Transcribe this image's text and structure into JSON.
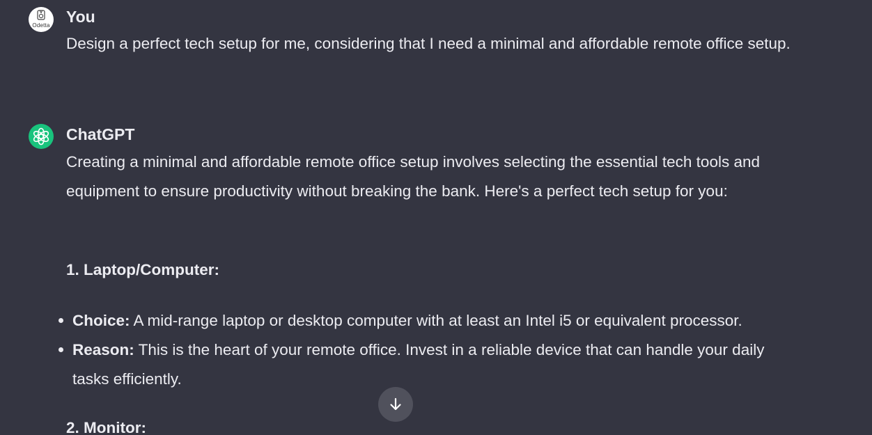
{
  "conversation": {
    "user": {
      "author": "You",
      "avatar_text": "Odetta",
      "message": "Design a perfect tech setup for me, considering that I need a minimal and affordable remote office setup."
    },
    "assistant": {
      "author": "ChatGPT",
      "intro": "Creating a minimal and affordable remote office setup involves selecting the essential tech tools and equipment to ensure productivity without breaking the bank. Here's a perfect tech setup for you:",
      "sections": [
        {
          "heading": "1. Laptop/Computer:",
          "bullets": [
            {
              "label": "Choice:",
              "text": " A mid-range laptop or desktop computer with at least an Intel i5 or equivalent processor."
            },
            {
              "label": "Reason:",
              "text": " This is the heart of your remote office. Invest in a reliable device that can handle your daily tasks efficiently."
            }
          ]
        },
        {
          "heading": "2. Monitor:",
          "bullets": []
        }
      ]
    }
  },
  "icons": {
    "scroll_down": "arrow-down-icon",
    "assistant_avatar": "openai-logo-icon"
  },
  "colors": {
    "background": "#343541",
    "text": "#ececf1",
    "assistant_avatar": "#19c37d",
    "scroll_button": "#50515c"
  }
}
